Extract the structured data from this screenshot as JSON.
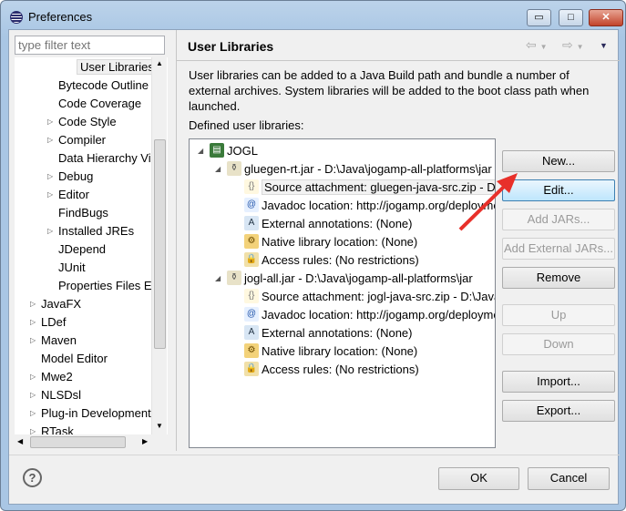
{
  "window": {
    "title": "Preferences",
    "minimize": "▭",
    "maximize": "□",
    "close": "✕"
  },
  "sidebar": {
    "filter_placeholder": "type filter text",
    "items": [
      {
        "label": "User Libraries",
        "level": 2,
        "expandable": false,
        "selected": true
      },
      {
        "label": "Bytecode Outline",
        "level": 2,
        "expandable": false
      },
      {
        "label": "Code Coverage",
        "level": 2,
        "expandable": false
      },
      {
        "label": "Code Style",
        "level": 2,
        "expandable": true
      },
      {
        "label": "Compiler",
        "level": 2,
        "expandable": true
      },
      {
        "label": "Data Hierarchy Vie",
        "level": 2,
        "expandable": false
      },
      {
        "label": "Debug",
        "level": 2,
        "expandable": true
      },
      {
        "label": "Editor",
        "level": 2,
        "expandable": true
      },
      {
        "label": "FindBugs",
        "level": 2,
        "expandable": false
      },
      {
        "label": "Installed JREs",
        "level": 2,
        "expandable": true
      },
      {
        "label": "JDepend",
        "level": 2,
        "expandable": false
      },
      {
        "label": "JUnit",
        "level": 2,
        "expandable": false
      },
      {
        "label": "Properties Files Ed",
        "level": 2,
        "expandable": false
      },
      {
        "label": "JavaFX",
        "level": 1,
        "expandable": true
      },
      {
        "label": "LDef",
        "level": 1,
        "expandable": true
      },
      {
        "label": "Maven",
        "level": 1,
        "expandable": true
      },
      {
        "label": "Model Editor",
        "level": 1,
        "expandable": false
      },
      {
        "label": "Mwe2",
        "level": 1,
        "expandable": true
      },
      {
        "label": "NLSDsl",
        "level": 1,
        "expandable": true
      },
      {
        "label": "Plug-in Development",
        "level": 1,
        "expandable": true
      },
      {
        "label": "RTask",
        "level": 1,
        "expandable": true
      }
    ]
  },
  "main": {
    "title": "User Libraries",
    "description": "User libraries can be added to a Java Build path and bundle a number of external archives. System libraries will be added to the boot class path when launched.",
    "defined_label": "Defined user libraries:",
    "tree": [
      {
        "label": "JOGL",
        "level": 0,
        "icon": "library-icon",
        "expanded": true
      },
      {
        "label": "gluegen-rt.jar - D:\\Java\\jogamp-all-platforms\\jar",
        "level": 1,
        "icon": "jar-icon",
        "expanded": true
      },
      {
        "label": "Source attachment: gluegen-java-src.zip - D:\\Java",
        "level": 2,
        "icon": "source-icon",
        "selected": true
      },
      {
        "label": "Javadoc location: http://jogamp.org/deployment",
        "level": 2,
        "icon": "javadoc-icon"
      },
      {
        "label": "External annotations: (None)",
        "level": 2,
        "icon": "annotations-icon"
      },
      {
        "label": "Native library location: (None)",
        "level": 2,
        "icon": "native-library-icon"
      },
      {
        "label": "Access rules: (No restrictions)",
        "level": 2,
        "icon": "access-rules-icon"
      },
      {
        "label": "jogl-all.jar - D:\\Java\\jogamp-all-platforms\\jar",
        "level": 1,
        "icon": "jar-icon",
        "expanded": true
      },
      {
        "label": "Source attachment: jogl-java-src.zip - D:\\Java",
        "level": 2,
        "icon": "source-icon"
      },
      {
        "label": "Javadoc location: http://jogamp.org/deployment",
        "level": 2,
        "icon": "javadoc-icon"
      },
      {
        "label": "External annotations: (None)",
        "level": 2,
        "icon": "annotations-icon"
      },
      {
        "label": "Native library location: (None)",
        "level": 2,
        "icon": "native-library-icon"
      },
      {
        "label": "Access rules: (No restrictions)",
        "level": 2,
        "icon": "access-rules-icon"
      }
    ],
    "buttons": [
      {
        "label": "New...",
        "enabled": true
      },
      {
        "label": "Edit...",
        "enabled": true,
        "focused": true
      },
      {
        "label": "Add JARs...",
        "enabled": false
      },
      {
        "label": "Add External JARs...",
        "enabled": false
      },
      {
        "label": "Remove",
        "enabled": true
      },
      {
        "label": "Up",
        "enabled": false
      },
      {
        "label": "Down",
        "enabled": false
      },
      {
        "label": "Import...",
        "enabled": true
      },
      {
        "label": "Export...",
        "enabled": true
      }
    ]
  },
  "footer": {
    "help": "?",
    "ok": "OK",
    "cancel": "Cancel"
  },
  "annotation": {
    "arrow_color": "#e8302a"
  }
}
